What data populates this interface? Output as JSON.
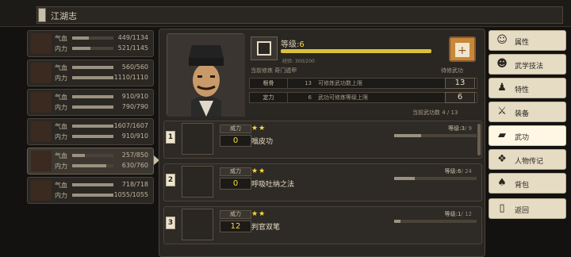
{
  "top": {
    "title": "江湖志"
  },
  "characters": [
    {
      "hp_label": "气血",
      "hp": "449/1134",
      "hp_frac": 0.4,
      "mp_label": "内力",
      "mp": "521/1145",
      "mp_frac": 0.45
    },
    {
      "hp_label": "气血",
      "hp": "560/560",
      "hp_frac": 1.0,
      "mp_label": "内力",
      "mp": "1110/1110",
      "mp_frac": 1.0
    },
    {
      "hp_label": "气血",
      "hp": "910/910",
      "hp_frac": 1.0,
      "mp_label": "内力",
      "mp": "790/790",
      "mp_frac": 1.0
    },
    {
      "hp_label": "气血",
      "hp": "1607/1607",
      "hp_frac": 1.0,
      "mp_label": "内力",
      "mp": "910/910",
      "mp_frac": 1.0
    },
    {
      "hp_label": "气血",
      "hp": "257/850",
      "hp_frac": 0.3,
      "mp_label": "内力",
      "mp": "630/760",
      "mp_frac": 0.83
    },
    {
      "hp_label": "气血",
      "hp": "718/718",
      "hp_frac": 1.0,
      "mp_label": "内力",
      "mp": "1055/1055",
      "mp_frac": 1.0
    }
  ],
  "header": {
    "level_label": "等级:",
    "level": "6",
    "level_progress": 0.5,
    "exp": "经验: 300/200",
    "current_training_label": "当前修炼",
    "current_training": "奇门遁甲",
    "training_button_label": "待修武功"
  },
  "stats": [
    {
      "name": "根骨",
      "value": "13",
      "desc": "可修炼武功数上限",
      "big": "13"
    },
    {
      "name": "定力",
      "value": "6",
      "desc": "武功可修炼等级上限",
      "big": "6"
    }
  ],
  "current_skills": {
    "label": "当前武功数",
    "value": "4 / 13"
  },
  "skills": [
    {
      "idx": "1",
      "power_label": "威力",
      "power": "0",
      "stars": "★★",
      "name": "嗡皮功",
      "level_label": "等级:",
      "level": "3",
      "level_max": "/ 9",
      "level_frac": 0.33
    },
    {
      "idx": "2",
      "power_label": "威力",
      "power": "0",
      "stars": "★★",
      "name": "呼吸吐纳之法",
      "level_label": "等级:",
      "level": "6",
      "level_max": "/ 24",
      "level_frac": 0.25
    },
    {
      "idx": "3",
      "power_label": "威力",
      "power": "12",
      "stars": "★★",
      "name": "判官双笔",
      "level_label": "等级:",
      "level": "1",
      "level_max": "/ 12",
      "level_frac": 0.08
    }
  ],
  "menu": [
    {
      "label": "属性",
      "icon": "person-icon",
      "glyph": "☺"
    },
    {
      "label": "武学技法",
      "icon": "skills-icon",
      "glyph": "☻"
    },
    {
      "label": "特性",
      "icon": "trait-icon",
      "glyph": "♟"
    },
    {
      "label": "装备",
      "icon": "sword-icon",
      "glyph": "⚔"
    },
    {
      "label": "武功",
      "icon": "book-icon",
      "glyph": "▰"
    },
    {
      "label": "人物传记",
      "icon": "biography-icon",
      "glyph": "❖"
    },
    {
      "label": "背包",
      "icon": "bag-icon",
      "glyph": "♠"
    },
    {
      "label": "返回",
      "icon": "back-icon",
      "glyph": "▯"
    }
  ],
  "colors": {
    "accent": "#ffdc3a",
    "panel": "#2a2622",
    "menu": "#e6dcc4"
  }
}
